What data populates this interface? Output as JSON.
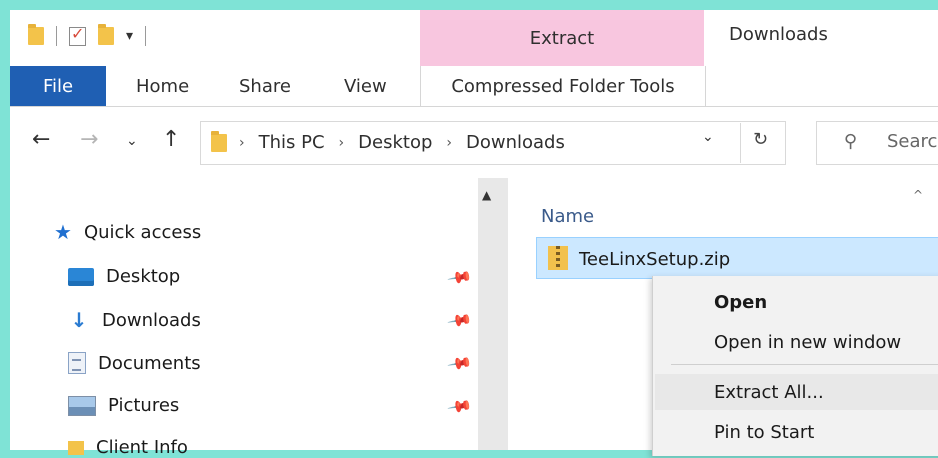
{
  "titlebar": {
    "context_tab": "Extract",
    "window_title": "Downloads"
  },
  "ribbon": {
    "file": "File",
    "home": "Home",
    "share": "Share",
    "view": "View",
    "compressed": "Compressed Folder Tools"
  },
  "address": {
    "crumbs": [
      "This PC",
      "Desktop",
      "Downloads"
    ],
    "search_placeholder": "Searc"
  },
  "navpane": {
    "quick_access": "Quick access",
    "items": [
      {
        "label": "Desktop",
        "icon": "desktop-icon",
        "pinned": true
      },
      {
        "label": "Downloads",
        "icon": "download-arrow-icon",
        "pinned": true
      },
      {
        "label": "Documents",
        "icon": "documents-icon",
        "pinned": true
      },
      {
        "label": "Pictures",
        "icon": "pictures-icon",
        "pinned": true
      },
      {
        "label": "Client Info",
        "icon": "folder-icon",
        "pinned": true
      }
    ]
  },
  "filelist": {
    "column_name": "Name",
    "selected_file": "TeeLinxSetup.zip"
  },
  "context_menu": {
    "items": [
      "Open",
      "Open in new window",
      "Extract All...",
      "Pin to Start"
    ]
  },
  "colors": {
    "file_tab": "#1f5fb3",
    "extract_context": "#f8c6df",
    "selection": "#cce8ff",
    "background": "#7fe3d6"
  }
}
